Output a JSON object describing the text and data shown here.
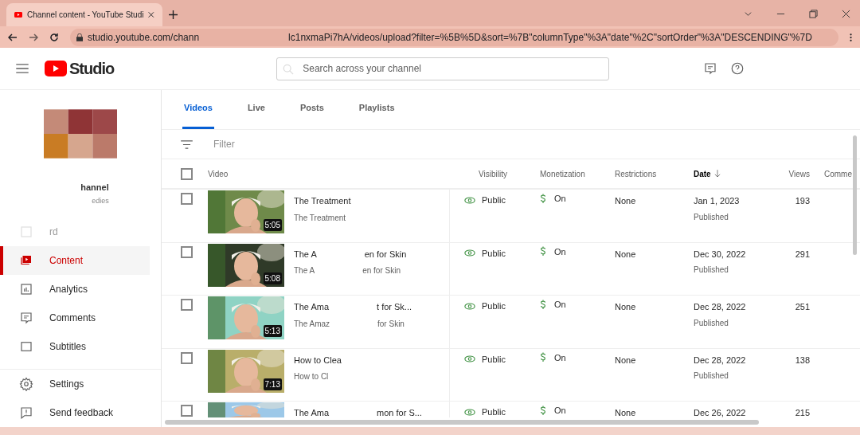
{
  "browser": {
    "tab_title": "Channel content - YouTube Studi",
    "url_parts": [
      "studio.youtube.com/chann",
      "lc1nxmaPi7hA/videos/upload?filter=%5B%5D&sort=%7B\"columnType\"%3A\"date\"%2C\"sortOrder\"%3A\"DESCENDING\"%7D"
    ]
  },
  "header": {
    "logo": "Studio",
    "search": {
      "placeholder": "Search across your channel"
    }
  },
  "channel": {
    "name": "hannel",
    "subtitle": "edies"
  },
  "sidebar": {
    "items": [
      {
        "label": "rd",
        "kind": "dashboard",
        "selected": false,
        "faded": true
      },
      {
        "label": "Content",
        "kind": "content",
        "selected": true,
        "faded": false
      },
      {
        "label": "Analytics",
        "kind": "analytics",
        "selected": false,
        "faded": false
      },
      {
        "label": "Comments",
        "kind": "comments",
        "selected": false,
        "faded": false
      },
      {
        "label": "Subtitles",
        "kind": "subtitles",
        "selected": false,
        "faded": false
      }
    ],
    "footer": [
      {
        "label": "Settings",
        "kind": "settings"
      },
      {
        "label": "Send feedback",
        "kind": "feedback"
      }
    ]
  },
  "tabs": [
    {
      "label": "Videos",
      "selected": true
    },
    {
      "label": "Live",
      "selected": false
    },
    {
      "label": "Posts",
      "selected": false
    },
    {
      "label": "Playlists",
      "selected": false
    }
  ],
  "filter": {
    "placeholder": "Filter"
  },
  "table": {
    "select_all": {
      "checked": false
    },
    "columns": [
      {
        "label": "Video",
        "sorted": false
      },
      {
        "label": "Visibility",
        "sorted": false
      },
      {
        "label": "Monetization",
        "sorted": false
      },
      {
        "label": "Restrictions",
        "sorted": false
      },
      {
        "label": "Date",
        "sorted": true
      },
      {
        "label": "Views",
        "sorted": false
      },
      {
        "label": "Comme",
        "sorted": false
      }
    ],
    "rows": [
      {
        "checked": false,
        "duration": "5:05",
        "title": [
          "The Treatment"
        ],
        "subtitle": [
          "The Treatment"
        ],
        "visibility": "Public",
        "monetization": "On",
        "restrictions": "None",
        "date": "Jan 1, 2023",
        "status": "Published",
        "views": "193"
      },
      {
        "checked": false,
        "duration": "5:08",
        "title": [
          "The A",
          "en for Skin"
        ],
        "subtitle": [
          "The A",
          "en for Skin"
        ],
        "visibility": "Public",
        "monetization": "On",
        "restrictions": "None",
        "date": "Dec 30, 2022",
        "status": "Published",
        "views": "291"
      },
      {
        "checked": false,
        "duration": "5:13",
        "title": [
          "The Ama",
          "t for Sk..."
        ],
        "subtitle": [
          "The Amaz",
          "for Skin"
        ],
        "visibility": "Public",
        "monetization": "On",
        "restrictions": "None",
        "date": "Dec 28, 2022",
        "status": "Published",
        "views": "251"
      },
      {
        "checked": false,
        "duration": "7:13",
        "title": [
          "How to Clea"
        ],
        "subtitle": [
          "How to Cl"
        ],
        "visibility": "Public",
        "monetization": "On",
        "restrictions": "None",
        "date": "Dec 28, 2022",
        "status": "Published",
        "views": "138"
      },
      {
        "checked": false,
        "title": [
          "The Ama",
          "mon for S..."
        ],
        "visibility": "Public",
        "monetization": "On",
        "restrictions": "None",
        "date": "Dec 26, 2022",
        "views": "215"
      }
    ]
  }
}
